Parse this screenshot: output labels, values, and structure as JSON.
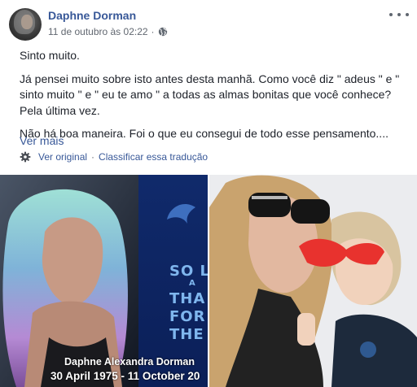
{
  "post": {
    "author": "Daphne Dorman",
    "timestamp": "11 de outubro às 02:22",
    "separator": "·",
    "paragraph1": "Sinto muito.",
    "paragraph2": "Já pensei muito sobre isto antes desta manhã. Como você diz \" adeus \" e \" sinto muito \" e \" eu te amo \" a todas as almas bonitas que você conhece? Pela última vez.",
    "paragraph3": "Não há boa maneira. Foi o que eu consegui de todo esse pensamento....",
    "see_more": "Ver mais"
  },
  "translation": {
    "see_original": "Ver original",
    "separator": "·",
    "rate": "Classificar essa tradução"
  },
  "photos": {
    "left": {
      "memorial_lines": [
        "SO L",
        "A",
        "THA",
        "FOR",
        "THE"
      ],
      "caption_name": "Daphne Alexandra Dorman",
      "caption_dates": "30 April 1975 - 11 October 20"
    }
  },
  "icons": {
    "more": "more-options-icon",
    "globe": "globe-icon",
    "gear": "gear-icon"
  },
  "colors": {
    "link": "#385898",
    "meta": "#616770",
    "text": "#1d2129"
  }
}
